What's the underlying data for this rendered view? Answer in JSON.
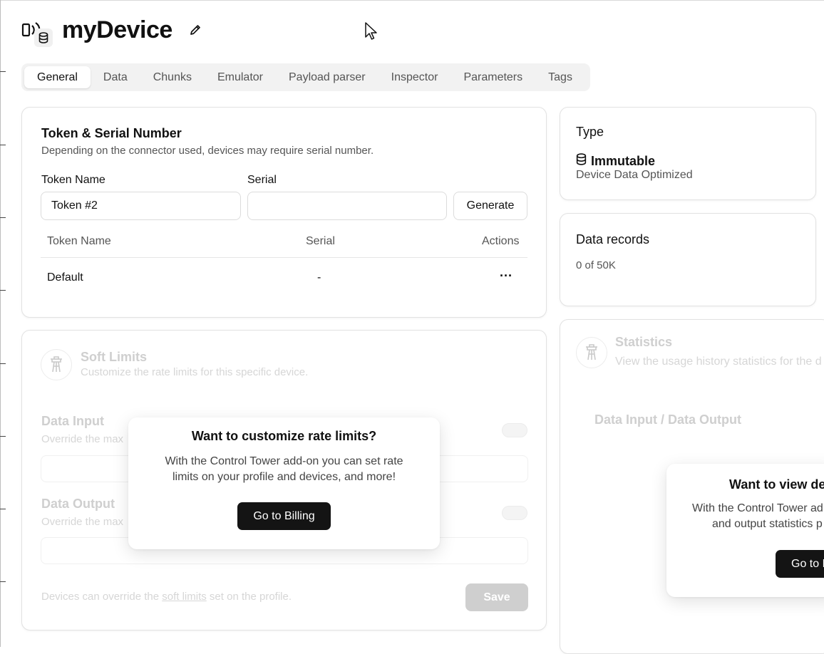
{
  "header": {
    "title": "myDevice",
    "device_icon": "device-signal-database-icon",
    "edit_icon": "pencil-icon"
  },
  "tabs": [
    {
      "label": "General",
      "active": true
    },
    {
      "label": "Data"
    },
    {
      "label": "Chunks"
    },
    {
      "label": "Emulator"
    },
    {
      "label": "Payload parser"
    },
    {
      "label": "Inspector"
    },
    {
      "label": "Parameters"
    },
    {
      "label": "Tags"
    }
  ],
  "token_card": {
    "title": "Token & Serial Number",
    "subtitle": "Depending on the connector used, devices may require serial number.",
    "token_name_label": "Token Name",
    "token_name_value": "Token #2",
    "serial_label": "Serial",
    "serial_value": "",
    "generate_label": "Generate",
    "table": {
      "headers": [
        "Token Name",
        "Serial",
        "Actions"
      ],
      "rows": [
        {
          "name": "Default",
          "serial": "-",
          "actions": "···"
        }
      ]
    }
  },
  "type_card": {
    "title": "Type",
    "value": "Immutable",
    "description": "Device Data Optimized",
    "icon": "database-icon"
  },
  "records_card": {
    "title": "Data records",
    "value": "0 of 50K"
  },
  "limits_card": {
    "title": "Soft Limits",
    "subtitle": "Customize the rate limits for this specific device.",
    "data_input_title": "Data Input",
    "data_input_sub": "Override the max",
    "data_output_title": "Data Output",
    "data_output_sub": "Override the max",
    "footer_before": "Devices can override the ",
    "footer_link": "soft limits",
    "footer_after": " set on the profile.",
    "save_label": "Save"
  },
  "limits_popup": {
    "title": "Want to customize rate limits?",
    "line1": "With the Control Tower add-on you can set rate",
    "line2": "limits on your profile and devices, and more!",
    "button": "Go to Billing"
  },
  "stats_card": {
    "title": "Statistics",
    "subtitle": "View the usage history statistics for the d",
    "chart_title": "Data Input / Data Output"
  },
  "stats_popup": {
    "title": "Want to view de",
    "line1": "With the Control Tower ad",
    "line2": "and output statistics p",
    "button": "Go to B"
  }
}
